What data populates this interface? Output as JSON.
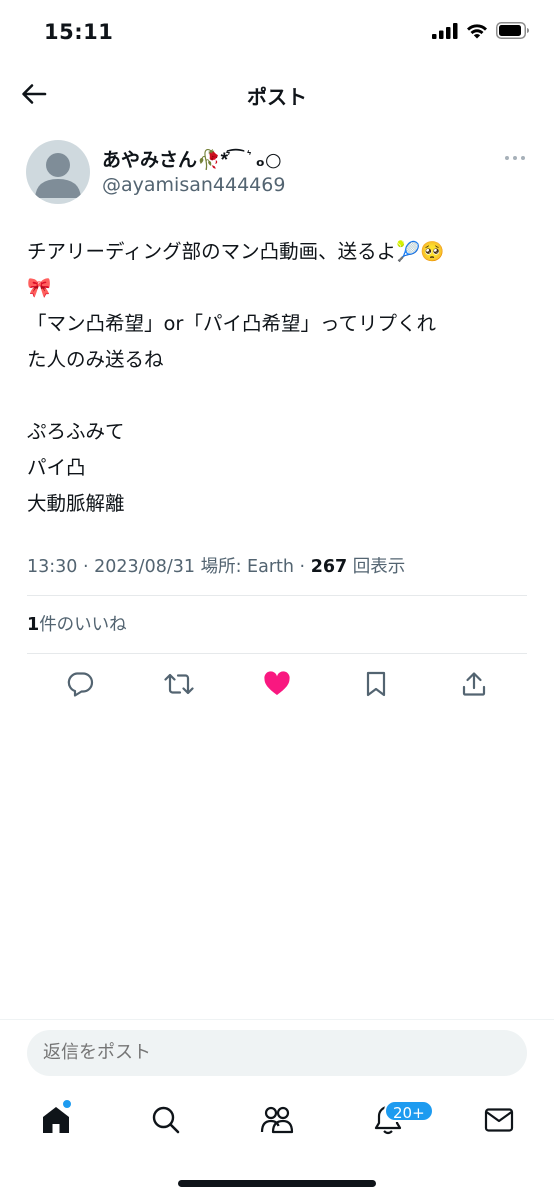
{
  "status_bar": {
    "time": "15:11"
  },
  "header": {
    "title": "ポスト"
  },
  "author": {
    "display_name": "あやみさん🥀*͛⁀ ͛ ₒ○",
    "username": "@ayamisan444469"
  },
  "tweet": {
    "lines": [
      "チアリーディング部のマン凸動画、送るよ🎾🥺",
      "🎀",
      "「マン凸希望」or「パイ凸希望」ってリプくれ",
      "た人のみ送るね",
      "",
      "ぷろふみて",
      "パイ凸",
      "大動脈解離"
    ]
  },
  "meta": {
    "time": "13:30",
    "date": "2023/08/31",
    "location_label": "場所: Earth",
    "view_count": "267",
    "view_label": "回表示"
  },
  "likes": {
    "count": "1",
    "label": "件のいいね"
  },
  "reply": {
    "placeholder": "返信をポスト"
  },
  "tab_bar": {
    "notifications_badge": "20+"
  },
  "colors": {
    "accent": "#1d9bf0",
    "like": "#f91880",
    "muted": "#536471"
  }
}
